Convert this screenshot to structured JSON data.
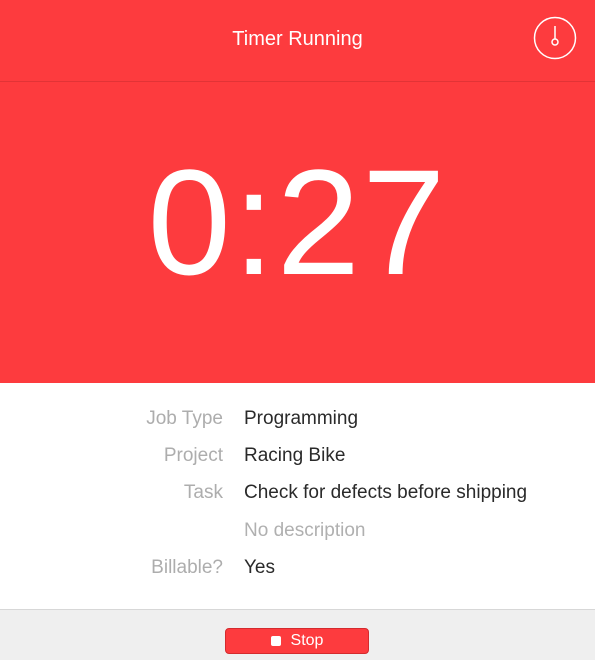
{
  "header": {
    "title": "Timer Running",
    "timer_icon": "stopwatch-icon"
  },
  "timer": {
    "elapsed": "0:27"
  },
  "details": [
    {
      "label": "Job Type",
      "value": "Programming"
    },
    {
      "label": "Project",
      "value": "Racing Bike"
    },
    {
      "label": "Task",
      "value": "Check for defects before shipping"
    },
    {
      "label": "",
      "value": "No description"
    },
    {
      "label": "Billable?",
      "value": "Yes"
    }
  ],
  "footer": {
    "stop_label": "Stop",
    "stop_icon": "stop-square-icon"
  },
  "colors": {
    "accent": "#fd3b3e",
    "footer_bg": "#efefef",
    "label_gray": "#adadad",
    "value_dark": "#2a2a2a"
  }
}
